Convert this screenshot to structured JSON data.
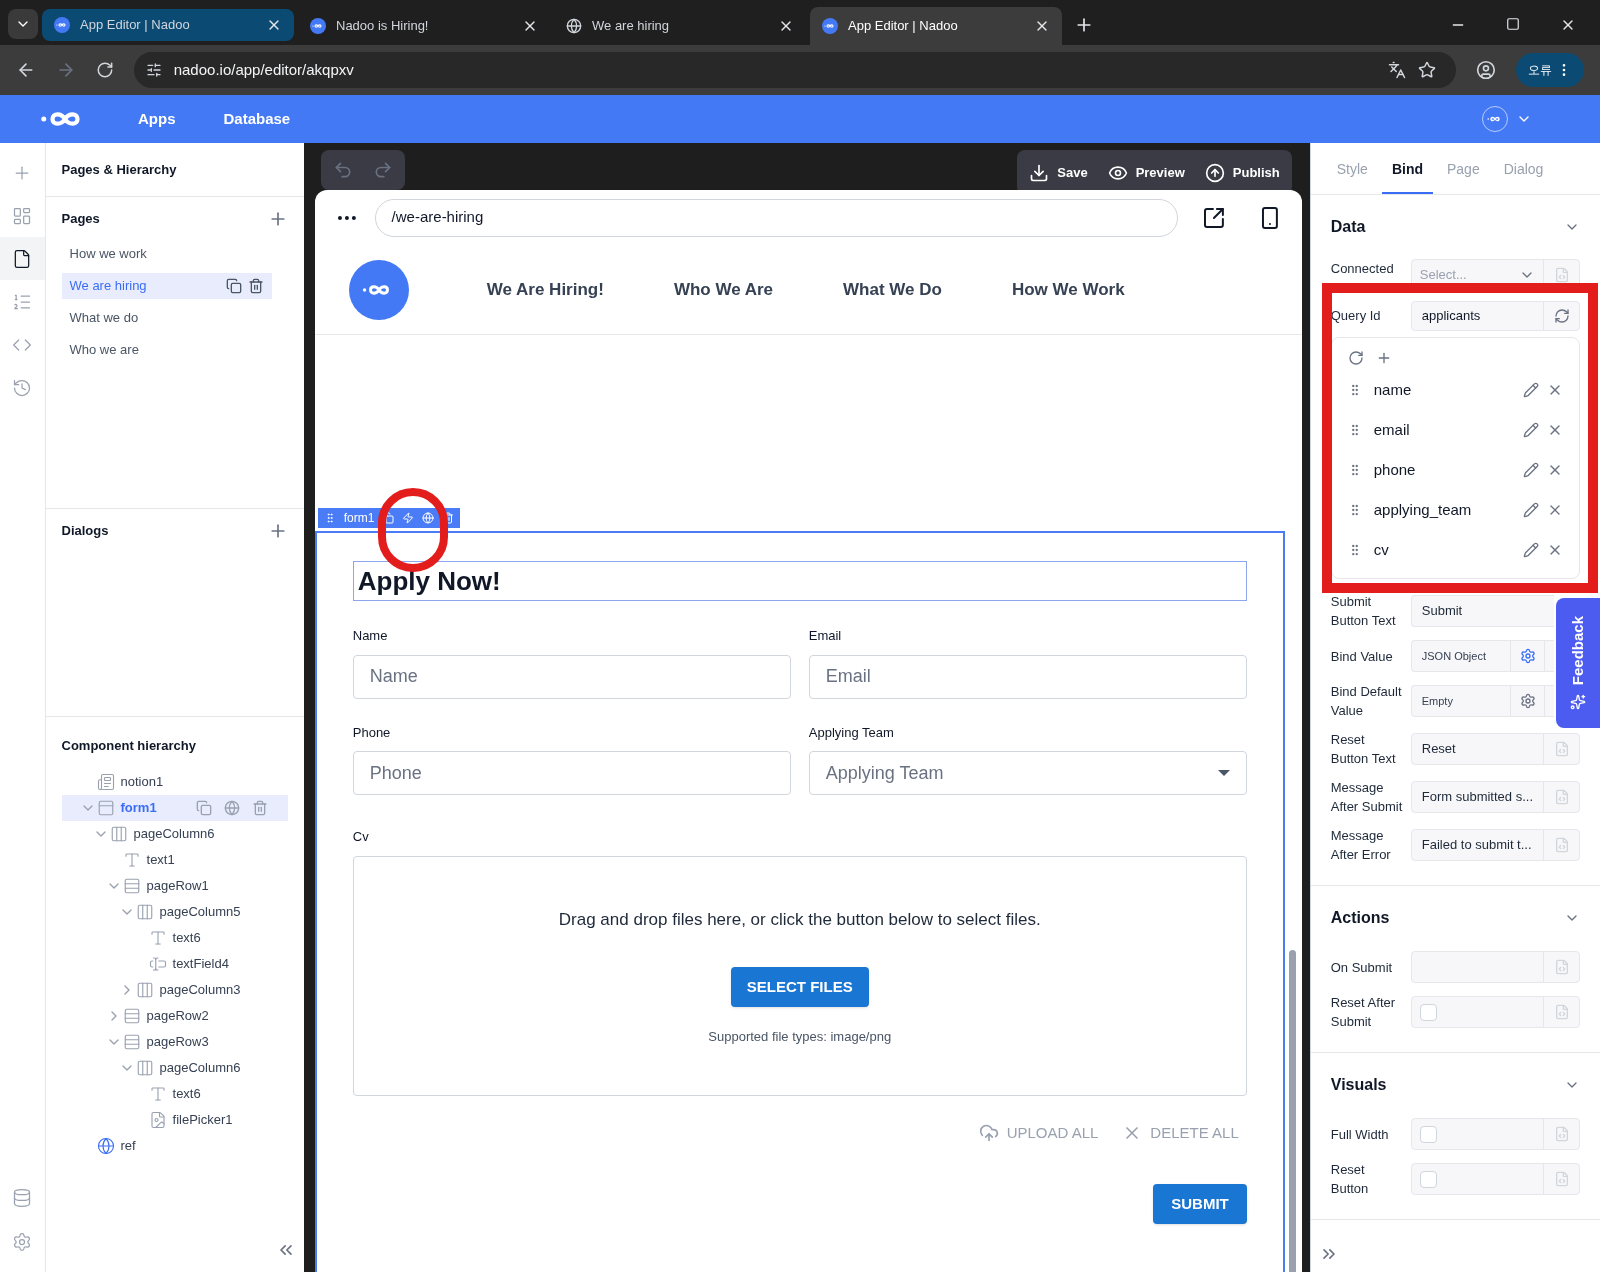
{
  "browser": {
    "tabs": [
      {
        "title": "App Editor | Nadoo",
        "kind": "app",
        "selected": false,
        "highlighted": true
      },
      {
        "title": "Nadoo is Hiring!",
        "kind": "app",
        "selected": false,
        "highlighted": false
      },
      {
        "title": "We are hiring",
        "kind": "globe",
        "selected": false,
        "highlighted": false
      },
      {
        "title": "App Editor | Nadoo",
        "kind": "app",
        "selected": true,
        "highlighted": false
      }
    ],
    "address": "nadoo.io/app/editor/akqpxv",
    "profile_button": "오류"
  },
  "app_header": {
    "nav": [
      "Apps",
      "Database"
    ]
  },
  "rail": [
    {
      "kind": "add",
      "selected": false
    },
    {
      "kind": "layout",
      "selected": false
    },
    {
      "kind": "pages",
      "selected": true
    },
    {
      "kind": "list",
      "selected": false
    },
    {
      "kind": "code",
      "selected": false
    },
    {
      "kind": "history",
      "selected": false
    }
  ],
  "left_panel": {
    "title": "Pages & Hierarchy",
    "pages": {
      "heading": "Pages",
      "items": [
        {
          "label": "How we work",
          "selected": false
        },
        {
          "label": "We are hiring",
          "selected": true
        },
        {
          "label": "What we do",
          "selected": false
        },
        {
          "label": "Who we are",
          "selected": false
        }
      ]
    },
    "dialogs": {
      "heading": "Dialogs"
    },
    "hierarchy": {
      "heading": "Component hierarchy",
      "tree": [
        {
          "label": "notion1",
          "kind": "notion",
          "selected": false
        },
        {
          "label": "form1",
          "kind": "form",
          "selected": true,
          "expanded": true,
          "children": [
            {
              "label": "pageColumn6",
              "kind": "column",
              "selected": false,
              "expanded": true,
              "children": [
                {
                  "label": "text1",
                  "kind": "text",
                  "selected": false
                },
                {
                  "label": "pageRow1",
                  "kind": "row",
                  "selected": false,
                  "expanded": true,
                  "children": [
                    {
                      "label": "pageColumn5",
                      "kind": "column",
                      "selected": false,
                      "expanded": true,
                      "children": [
                        {
                          "label": "text6",
                          "kind": "text",
                          "selected": false
                        },
                        {
                          "label": "textField4",
                          "kind": "textfield",
                          "selected": false
                        }
                      ]
                    },
                    {
                      "label": "pageColumn3",
                      "kind": "column",
                      "selected": false,
                      "expanded": false
                    }
                  ]
                },
                {
                  "label": "pageRow2",
                  "kind": "row",
                  "selected": false,
                  "expanded": false
                },
                {
                  "label": "pageRow3",
                  "kind": "row",
                  "selected": false,
                  "expanded": true,
                  "children": [
                    {
                      "label": "pageColumn6",
                      "kind": "column",
                      "selected": false,
                      "expanded": true,
                      "children": [
                        {
                          "label": "text6",
                          "kind": "text",
                          "selected": false
                        },
                        {
                          "label": "filePicker1",
                          "kind": "filepicker",
                          "selected": false
                        }
                      ]
                    }
                  ]
                }
              ]
            }
          ]
        },
        {
          "label": "ref",
          "kind": "ref",
          "selected": false
        }
      ]
    }
  },
  "canvas": {
    "actions": [
      {
        "label": "Save",
        "kind": "save"
      },
      {
        "label": "Preview",
        "kind": "preview"
      },
      {
        "label": "Publish",
        "kind": "publish"
      }
    ],
    "url": "/we-are-hiring",
    "site_nav": [
      "We Are Hiring!",
      "Who We Are",
      "What We Do",
      "How We Work"
    ],
    "form": {
      "tag": "form1",
      "title": "Apply Now!",
      "fields": [
        {
          "label": "Name",
          "placeholder": "Name",
          "kind": "text"
        },
        {
          "label": "Email",
          "placeholder": "Email",
          "kind": "text"
        },
        {
          "label": "Phone",
          "placeholder": "Phone",
          "kind": "text"
        },
        {
          "label": "Applying Team",
          "placeholder": "Applying Team",
          "kind": "select"
        }
      ],
      "file": {
        "label": "Cv",
        "prompt": "Drag and drop files here, or click the button below to select files.",
        "button": "SELECT FILES",
        "hint": "Supported file types: image/png",
        "actions": [
          {
            "label": "UPLOAD ALL",
            "kind": "upload"
          },
          {
            "label": "DELETE ALL",
            "kind": "delete"
          }
        ]
      },
      "submit": "SUBMIT"
    }
  },
  "right_panel": {
    "tabs": [
      {
        "label": "Style",
        "selected": false
      },
      {
        "label": "Bind",
        "selected": true
      },
      {
        "label": "Page",
        "selected": false
      },
      {
        "label": "Dialog",
        "selected": false
      }
    ],
    "data": {
      "heading": "Data",
      "connected": {
        "label": "Connected",
        "placeholder": "Select..."
      },
      "query": {
        "label": "Query Id",
        "value": "applicants"
      },
      "columns": [
        "name",
        "email",
        "phone",
        "applying_team",
        "cv"
      ],
      "rows": [
        {
          "label": "Submit Button Text",
          "kind": "input",
          "value": "Submit"
        },
        {
          "label": "Bind Value",
          "kind": "gear",
          "value": "JSON Object"
        },
        {
          "label": "Bind Default Value",
          "kind": "gear",
          "value": "Empty"
        },
        {
          "label": "Reset Button Text",
          "kind": "input",
          "value": "Reset"
        },
        {
          "label": "Message After Submit",
          "kind": "input",
          "value": "Form submitted s..."
        },
        {
          "label": "Message After Error",
          "kind": "input",
          "value": "Failed to submit t..."
        }
      ]
    },
    "actions": {
      "heading": "Actions",
      "rows": [
        {
          "label": "On Submit",
          "kind": "input"
        },
        {
          "label": "Reset After Submit",
          "kind": "checkbox",
          "checked": false
        }
      ]
    },
    "visuals": {
      "heading": "Visuals",
      "rows": [
        {
          "label": "Full Width",
          "kind": "checkbox",
          "checked": false
        },
        {
          "label": "Reset Button",
          "kind": "checkbox",
          "checked": false
        }
      ]
    }
  },
  "feedback": "Feedback",
  "annotations": [
    {
      "kind": "frame"
    },
    {
      "kind": "circle"
    }
  ]
}
